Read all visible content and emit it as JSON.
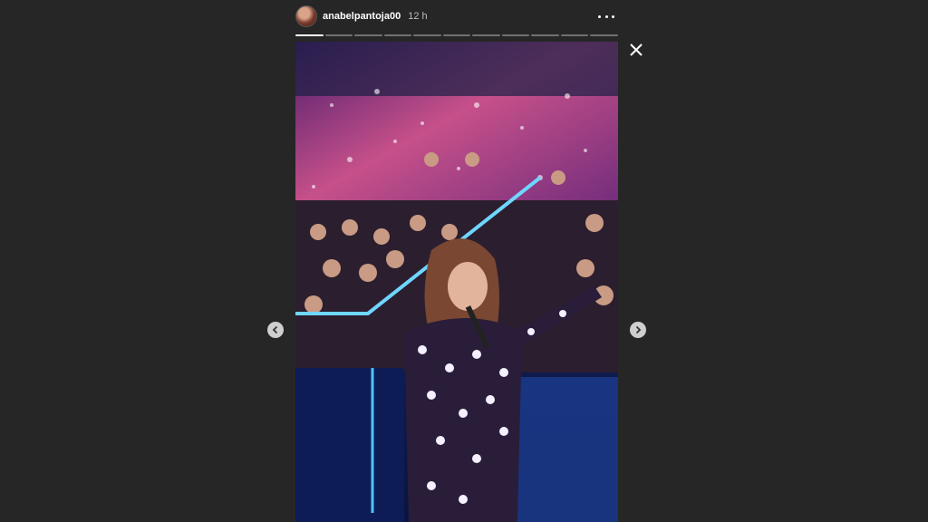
{
  "story": {
    "username": "anabelpantoja00",
    "timestamp": "12 h",
    "segments_total": 11,
    "segments_viewed": 1,
    "icons": {
      "more": "more-options-icon",
      "close": "close-icon",
      "prev": "chevron-left-icon",
      "next": "chevron-right-icon"
    }
  },
  "colors": {
    "background": "#262626",
    "text": "#ffffff",
    "muted": "#bdbdbd",
    "nav_button": "#cfcfcf"
  }
}
